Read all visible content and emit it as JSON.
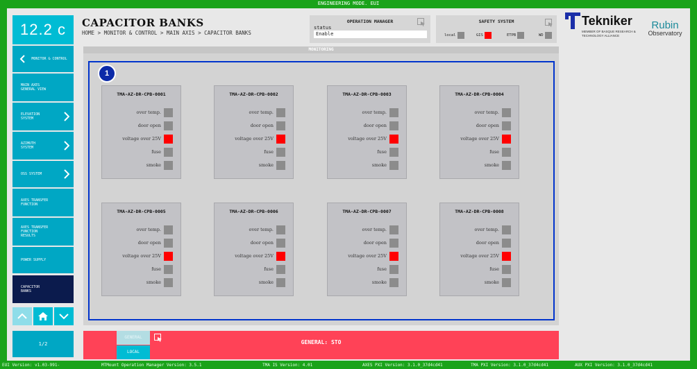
{
  "mode_banner": "ENGINEERING MODE. EUI",
  "temperature": "12.2 c",
  "page_title": "CAPACITOR BANKS",
  "breadcrumb": "HOME > MONITOR & CONTROL > MAIN AXIS > CAPACITOR BANKS",
  "operation_manager": {
    "title": "OPERATION MANAGER",
    "status_label": "status",
    "status_value": "Enable"
  },
  "safety_system": {
    "title": "SAFETY SYSTEM",
    "indicators": [
      {
        "label": "local",
        "state": "gray"
      },
      {
        "label": "GIS",
        "state": "red"
      },
      {
        "label": "ETPB",
        "state": "gray"
      },
      {
        "label": "WD",
        "state": "gray"
      }
    ]
  },
  "logos": {
    "tekniker": {
      "name": "Tekniker",
      "tagline": "MEMBER OF BASQUE RESEARCH & TECHNOLOGY ALLIANCE"
    },
    "rubin": {
      "name": "Rubin",
      "subtitle": "Observatory"
    }
  },
  "sidebar": {
    "items": [
      {
        "label": "MONITOR & CONTROL",
        "kind": "back"
      },
      {
        "label": "MAIN AXES GENERAL VIEW",
        "kind": "plain"
      },
      {
        "label": "ELEVATION SYSTEM",
        "kind": "chevron"
      },
      {
        "label": "AZIMUTH SYSTEM",
        "kind": "chevron"
      },
      {
        "label": "OSS SYSTEM",
        "kind": "chevron"
      },
      {
        "label": "AXES TRANSFER FUNCTION",
        "kind": "plain"
      },
      {
        "label": "AXES TRANSFER FUNCTION RESULTS",
        "kind": "plain"
      },
      {
        "label": "POWER SUPPLY",
        "kind": "plain"
      },
      {
        "label": "CAPACITOR BANKS",
        "kind": "active"
      }
    ],
    "pager": "1/2"
  },
  "monitoring": {
    "title": "MONITORING",
    "badge": "1",
    "row_labels": [
      "over temp.",
      "door open",
      "voltage over 25V",
      "fuse",
      "smoke"
    ],
    "banks": [
      {
        "name": "TMA-AZ-DR-CPB-0001",
        "states": [
          "gray",
          "gray",
          "red",
          "gray",
          "gray"
        ]
      },
      {
        "name": "TMA-AZ-DR-CPB-0002",
        "states": [
          "gray",
          "gray",
          "red",
          "gray",
          "gray"
        ]
      },
      {
        "name": "TMA-AZ-DR-CPB-0003",
        "states": [
          "gray",
          "gray",
          "red",
          "gray",
          "gray"
        ]
      },
      {
        "name": "TMA-AZ-DR-CPB-0004",
        "states": [
          "gray",
          "gray",
          "red",
          "gray",
          "gray"
        ]
      },
      {
        "name": "TMA-AZ-DR-CPB-0005",
        "states": [
          "gray",
          "gray",
          "red",
          "gray",
          "gray"
        ]
      },
      {
        "name": "TMA-AZ-DR-CPB-0006",
        "states": [
          "gray",
          "gray",
          "red",
          "gray",
          "gray"
        ]
      },
      {
        "name": "TMA-AZ-DR-CPB-0007",
        "states": [
          "gray",
          "gray",
          "red",
          "gray",
          "gray"
        ]
      },
      {
        "name": "TMA-AZ-DR-CPB-0008",
        "states": [
          "gray",
          "gray",
          "red",
          "gray",
          "gray"
        ]
      }
    ]
  },
  "general_bar": {
    "tab_general": "GENERAL",
    "tab_local": "LOCAL",
    "status": "GENERAL: STO"
  },
  "footer": {
    "eui_version": "EUI Version: v1.03-991-",
    "mtmount_version": "MTMount Operation Manager Version: 3.5.1",
    "tma_is_version": "TMA IS Version: 4.01",
    "axes_pxi_version": "AXES PXI Version: 3.1.0_37d4cd41",
    "tma_pxi_version": "TMA PXI Version: 3.1.0_37d4cd41",
    "aux_pxi_version": "AUX PXI Version: 3.1.0_37d4cd41"
  },
  "colors": {
    "accent": "#00a7c4",
    "active": "#0b1b4d",
    "alarm": "#ff0000",
    "frame": "#0033cc",
    "general_bar": "#ff4257",
    "chrome": "#1aa31a"
  }
}
